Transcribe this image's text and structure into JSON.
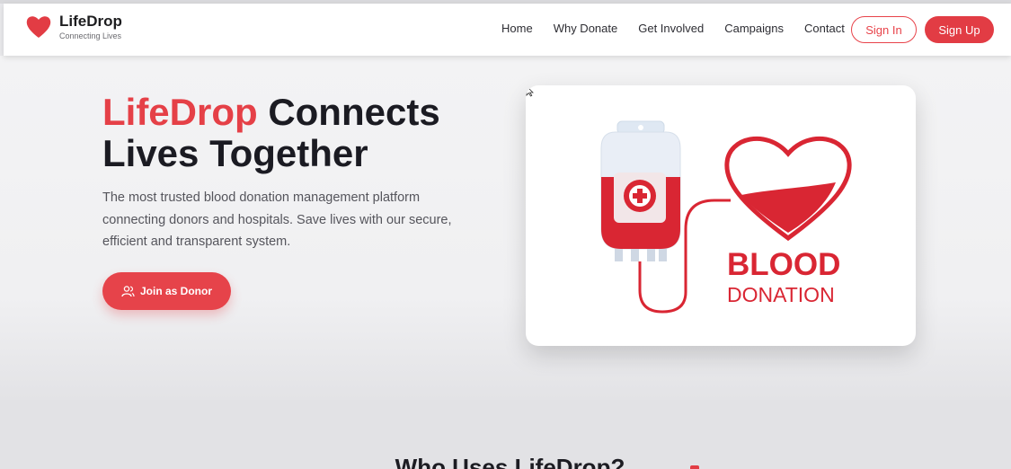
{
  "brand": {
    "name": "LifeDrop",
    "tagline": "Connecting Lives",
    "accent_color": "#e54047"
  },
  "nav": {
    "links": [
      "Home",
      "Why Donate",
      "Get Involved",
      "Campaigns",
      "Contact"
    ],
    "sign_in": "Sign In",
    "sign_up": "Sign Up"
  },
  "hero": {
    "title_accent": "LifeDrop",
    "title_rest": " Connects Lives Together",
    "description": "The most trusted blood donation management platform connecting donors and hospitals. Save lives with our secure, efficient and transparent system.",
    "cta": "Join as Donor",
    "cta_icon": "users-icon"
  },
  "illustration": {
    "line1": "BLOOD",
    "line2": "DONATION",
    "icons": [
      "blood-bag-icon",
      "heart-icon",
      "medical-cross-icon"
    ]
  },
  "section": {
    "title": "Who Uses LifeDrop?"
  }
}
